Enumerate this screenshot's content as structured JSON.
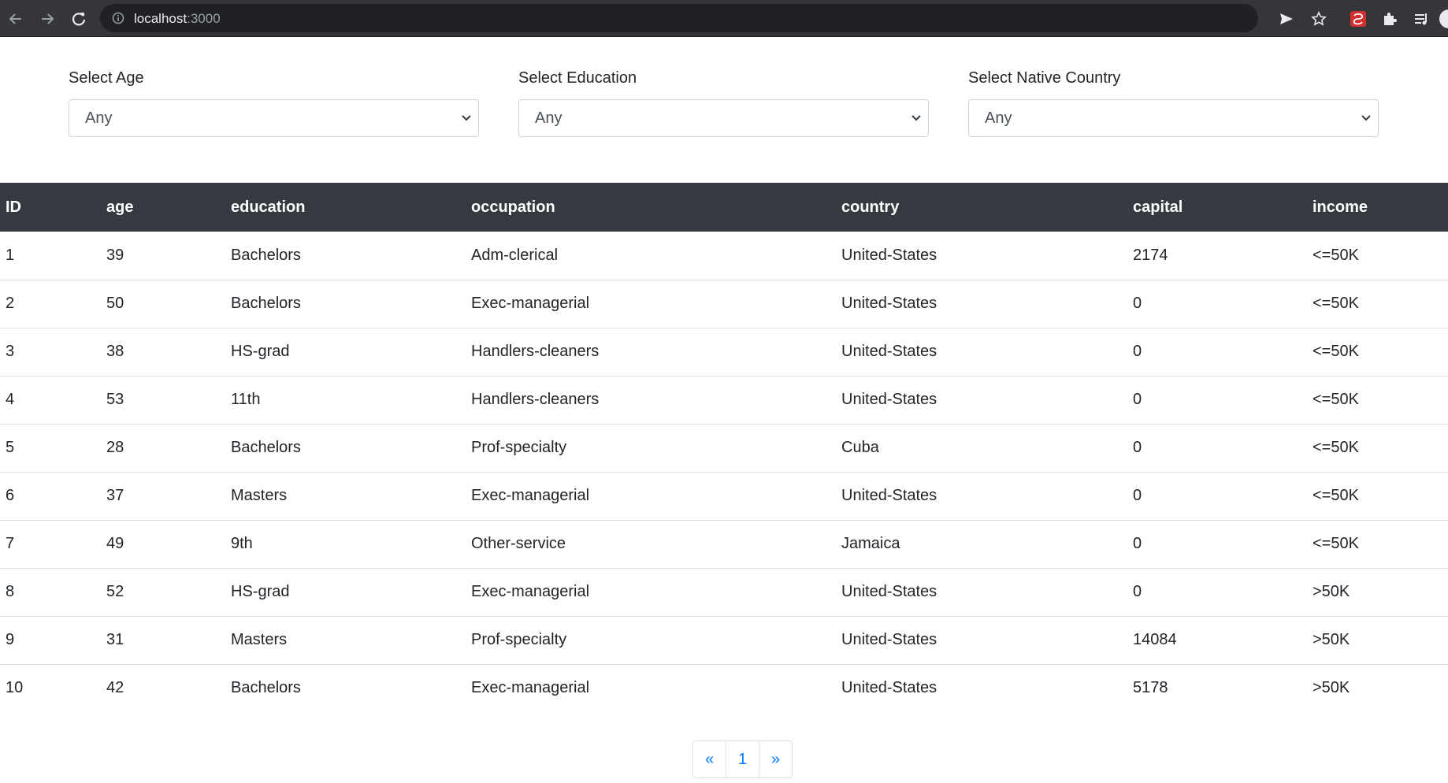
{
  "browser": {
    "url_host": "localhost",
    "url_port": ":3000"
  },
  "filters": [
    {
      "label": "Select Age",
      "value": "Any"
    },
    {
      "label": "Select Education",
      "value": "Any"
    },
    {
      "label": "Select Native Country",
      "value": "Any"
    }
  ],
  "table": {
    "headers": [
      "ID",
      "age",
      "education",
      "occupation",
      "country",
      "capital",
      "income"
    ],
    "rows": [
      [
        "1",
        "39",
        "Bachelors",
        "Adm-clerical",
        "United-States",
        "2174",
        "<=50K"
      ],
      [
        "2",
        "50",
        "Bachelors",
        "Exec-managerial",
        "United-States",
        "0",
        "<=50K"
      ],
      [
        "3",
        "38",
        "HS-grad",
        "Handlers-cleaners",
        "United-States",
        "0",
        "<=50K"
      ],
      [
        "4",
        "53",
        "11th",
        "Handlers-cleaners",
        "United-States",
        "0",
        "<=50K"
      ],
      [
        "5",
        "28",
        "Bachelors",
        "Prof-specialty",
        "Cuba",
        "0",
        "<=50K"
      ],
      [
        "6",
        "37",
        "Masters",
        "Exec-managerial",
        "United-States",
        "0",
        "<=50K"
      ],
      [
        "7",
        "49",
        "9th",
        "Other-service",
        "Jamaica",
        "0",
        "<=50K"
      ],
      [
        "8",
        "52",
        "HS-grad",
        "Exec-managerial",
        "United-States",
        "0",
        ">50K"
      ],
      [
        "9",
        "31",
        "Masters",
        "Prof-specialty",
        "United-States",
        "14084",
        ">50K"
      ],
      [
        "10",
        "42",
        "Bachelors",
        "Exec-managerial",
        "United-States",
        "5178",
        ">50K"
      ]
    ]
  },
  "pagination": {
    "prev": "«",
    "current": "1",
    "next": "»"
  },
  "colors": {
    "header_bg": "#343a40",
    "link": "#007bff",
    "chrome_bg": "#35363a"
  },
  "icons": [
    "back-arrow-icon",
    "forward-arrow-icon",
    "reload-icon",
    "info-icon",
    "send-icon",
    "star-icon",
    "extension-red-icon",
    "puzzle-icon",
    "media-queue-icon",
    "profile-icon"
  ]
}
